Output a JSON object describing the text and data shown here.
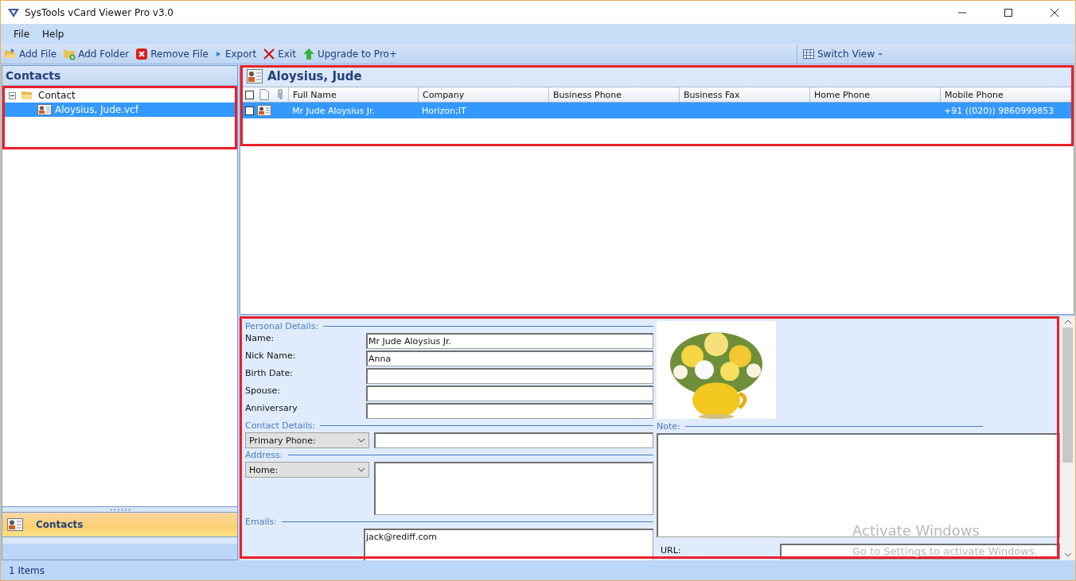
{
  "window": {
    "title": "SysTools vCard Viewer Pro v3.0"
  },
  "menu": [
    "File",
    "Help"
  ],
  "toolbar": [
    {
      "label": "Add File",
      "kind": "open"
    },
    {
      "label": "Add Folder",
      "kind": "folder"
    },
    {
      "label": "Remove File",
      "kind": "remove"
    },
    {
      "label": "Export",
      "kind": "export"
    },
    {
      "label": "Exit",
      "kind": "exit"
    },
    {
      "label": "Upgrade to Pro+",
      "kind": "upgrade"
    }
  ],
  "switch_view": {
    "label": "Switch View"
  },
  "sidebar": {
    "title": "Contacts",
    "tree": [
      {
        "label": "Contact",
        "expanded": true,
        "children": [
          {
            "label": "Aloysius, Jude.vcf",
            "selected": true
          }
        ]
      }
    ],
    "nav_button": "Contacts"
  },
  "contact_list": {
    "title": "Aloysius, Jude",
    "select_all_checked": false,
    "columns": [
      "Full Name",
      "Company",
      "Business Phone",
      "Business Fax",
      "Home Phone",
      "Mobile Phone"
    ],
    "rows": [
      {
        "checked": false,
        "selected": true,
        "full_name": "Mr Jude Aloysius Jr.",
        "company": "Horizon;IT",
        "mobile_phone": "+91 ((020)) 9860999853"
      }
    ]
  },
  "details": {
    "personal": {
      "heading": "Personal Details:",
      "fields": [
        {
          "label": "Name:",
          "value": "Mr Jude Aloysius Jr."
        },
        {
          "label": "Nick Name:",
          "value": "Anna"
        },
        {
          "label": "Birth Date:"
        },
        {
          "label": "Spouse:"
        },
        {
          "label": "Anniversary"
        }
      ]
    },
    "contact": {
      "heading": "Contact Details:",
      "select": "Primary Phone:"
    },
    "address": {
      "heading": "Address:",
      "select": "Home:"
    },
    "emails": {
      "heading": "Emails:",
      "value": "jack@rediff.com"
    },
    "note": {
      "heading": "Note:"
    },
    "url": {
      "label": "URL:"
    }
  },
  "highlights": {
    "tree": true,
    "list": true,
    "details": true
  },
  "os_notice": {
    "title": "Activate Windows",
    "subtitle": "Go to Settings to activate Windows."
  },
  "status_bar": "1 Items"
}
